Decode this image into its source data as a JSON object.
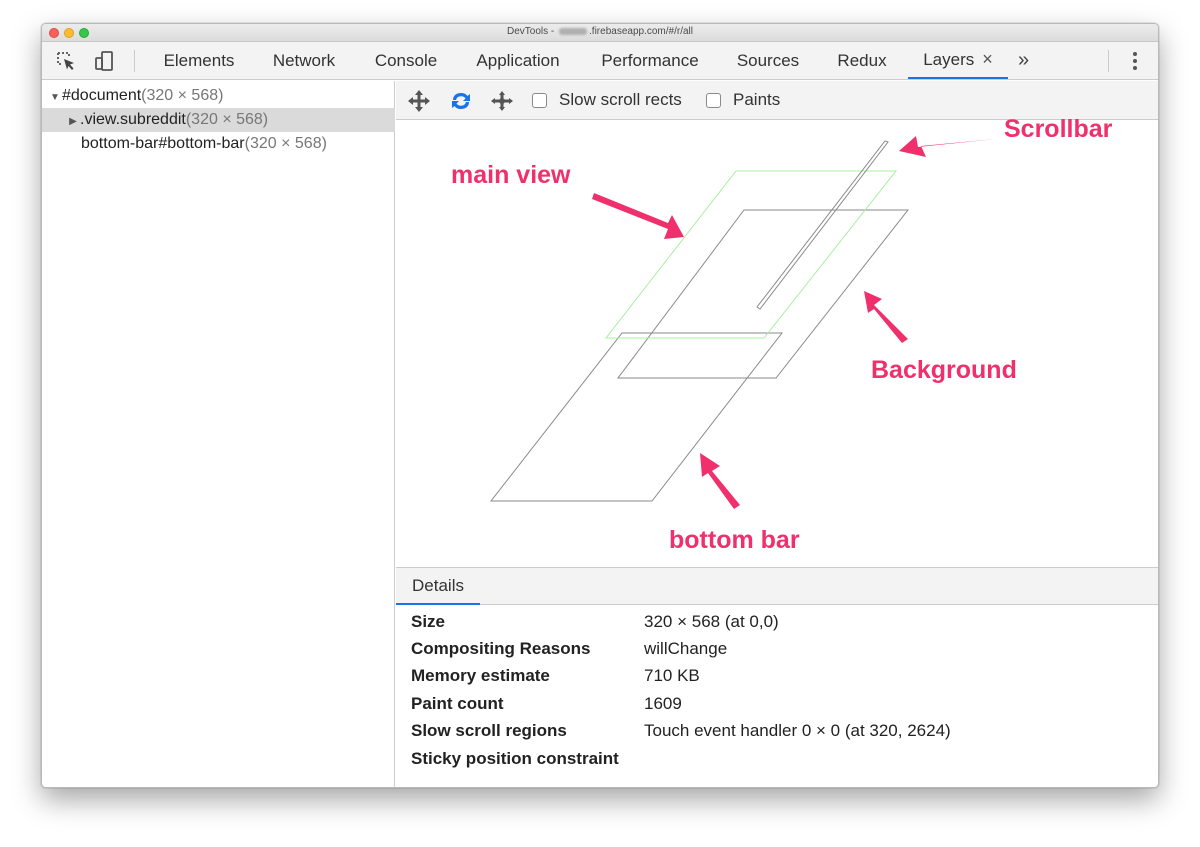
{
  "window": {
    "title_prefix": "DevTools - ",
    "title_suffix": ".firebaseapp.com/#/r/all"
  },
  "tabs": [
    {
      "label": "Elements"
    },
    {
      "label": "Network"
    },
    {
      "label": "Console"
    },
    {
      "label": "Application"
    },
    {
      "label": "Performance"
    },
    {
      "label": "Sources"
    },
    {
      "label": "Redux"
    },
    {
      "label": "Layers",
      "active": true
    }
  ],
  "tab_close": "×",
  "more_tabs": "»",
  "layer_tree": [
    {
      "name": "#document",
      "size": "(320 × 568)",
      "expanded": true
    },
    {
      "name": ".view.subreddit",
      "size": "(320 × 568)",
      "selected": true
    },
    {
      "name": "bottom-bar#bottom-bar",
      "size": "(320 × 568)"
    }
  ],
  "layers_toolbar": {
    "slow_scroll_rects": "Slow scroll rects",
    "paints": "Paints"
  },
  "annotations": {
    "scrollbar": "Scrollbar",
    "main_view": "main view",
    "background": "Background",
    "bottom_bar": "bottom bar"
  },
  "details_tab": "Details",
  "details": [
    {
      "key": "Size",
      "value": "320 × 568 (at 0,0)"
    },
    {
      "key": "Compositing Reasons",
      "value": "willChange"
    },
    {
      "key": "Memory estimate",
      "value": "710 KB"
    },
    {
      "key": "Paint count",
      "value": "1609"
    },
    {
      "key": "Slow scroll regions",
      "value": "Touch event handler 0 × 0 (at 320, 2624)"
    },
    {
      "key": "Sticky position constraint",
      "value": ""
    }
  ],
  "colors": {
    "accent": "#1a73e8",
    "annotation": "#f0306c",
    "main_view_outline": "#a8f0a0",
    "layer_outline": "#8a8a8a"
  }
}
